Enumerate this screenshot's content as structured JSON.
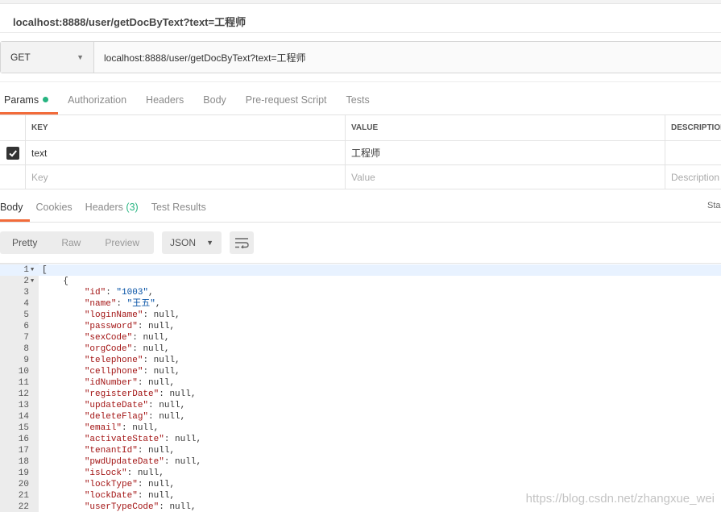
{
  "tab_title": "localhost:8888/user/getDocByText?text=工程师",
  "request": {
    "method": "GET",
    "url": "localhost:8888/user/getDocByText?text=工程师"
  },
  "request_tabs": [
    {
      "label": "Params",
      "active": true
    },
    {
      "label": "Authorization"
    },
    {
      "label": "Headers"
    },
    {
      "label": "Body"
    },
    {
      "label": "Pre-request Script"
    },
    {
      "label": "Tests"
    }
  ],
  "params": {
    "headers": {
      "key": "KEY",
      "value": "VALUE",
      "description": "DESCRIPTION"
    },
    "rows": [
      {
        "checked": true,
        "key": "text",
        "value": "工程师",
        "description": ""
      }
    ],
    "new_row_placeholders": {
      "key": "Key",
      "value": "Value",
      "description": "Description"
    }
  },
  "response_tabs": {
    "body": "Body",
    "cookies": "Cookies",
    "headers": "Headers",
    "headers_count": "(3)",
    "test_results": "Test Results"
  },
  "status_label": "Sta",
  "view_modes": [
    "Pretty",
    "Raw",
    "Preview"
  ],
  "format": "JSON",
  "colors": {
    "accent": "#f26b3a",
    "success": "#27b481",
    "json_key": "#a31515",
    "json_string": "#0451a5"
  },
  "code_lines": [
    {
      "n": "1",
      "fold": true,
      "text": "["
    },
    {
      "n": "2",
      "fold": true,
      "text": "    {"
    },
    {
      "n": "3",
      "key": "\"id\"",
      "val": "\"1003\"",
      "vtype": "str"
    },
    {
      "n": "4",
      "key": "\"name\"",
      "val": "\"王五\"",
      "vtype": "str"
    },
    {
      "n": "5",
      "key": "\"loginName\"",
      "val": "null",
      "vtype": "nul"
    },
    {
      "n": "6",
      "key": "\"password\"",
      "val": "null",
      "vtype": "nul"
    },
    {
      "n": "7",
      "key": "\"sexCode\"",
      "val": "null",
      "vtype": "nul"
    },
    {
      "n": "8",
      "key": "\"orgCode\"",
      "val": "null",
      "vtype": "nul"
    },
    {
      "n": "9",
      "key": "\"telephone\"",
      "val": "null",
      "vtype": "nul"
    },
    {
      "n": "10",
      "key": "\"cellphone\"",
      "val": "null",
      "vtype": "nul"
    },
    {
      "n": "11",
      "key": "\"idNumber\"",
      "val": "null",
      "vtype": "nul"
    },
    {
      "n": "12",
      "key": "\"registerDate\"",
      "val": "null",
      "vtype": "nul"
    },
    {
      "n": "13",
      "key": "\"updateDate\"",
      "val": "null",
      "vtype": "nul"
    },
    {
      "n": "14",
      "key": "\"deleteFlag\"",
      "val": "null",
      "vtype": "nul"
    },
    {
      "n": "15",
      "key": "\"email\"",
      "val": "null",
      "vtype": "nul"
    },
    {
      "n": "16",
      "key": "\"activateState\"",
      "val": "null",
      "vtype": "nul"
    },
    {
      "n": "17",
      "key": "\"tenantId\"",
      "val": "null",
      "vtype": "nul"
    },
    {
      "n": "18",
      "key": "\"pwdUpdateDate\"",
      "val": "null",
      "vtype": "nul"
    },
    {
      "n": "19",
      "key": "\"isLock\"",
      "val": "null",
      "vtype": "nul"
    },
    {
      "n": "20",
      "key": "\"lockType\"",
      "val": "null",
      "vtype": "nul"
    },
    {
      "n": "21",
      "key": "\"lockDate\"",
      "val": "null",
      "vtype": "nul"
    },
    {
      "n": "22",
      "key": "\"userTypeCode\"",
      "val": "null",
      "vtype": "nul"
    }
  ],
  "watermark": "https://blog.csdn.net/zhangxue_wei"
}
